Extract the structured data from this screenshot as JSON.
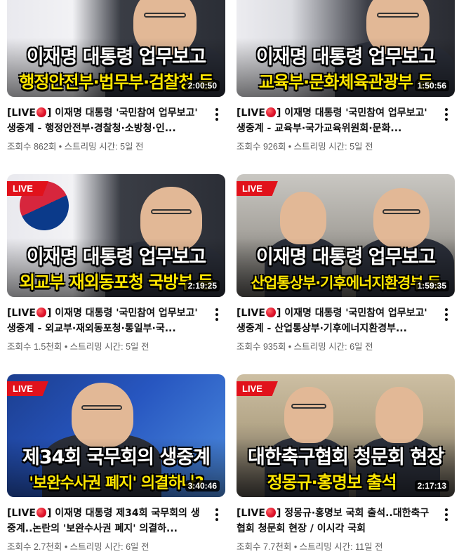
{
  "videos": [
    {
      "caption_top": "이재명 대통령 업무보고",
      "caption_bottom": "행정안전부·법무부·검찰청 등",
      "live_badge": "",
      "duration": "2:00:50",
      "title_prefix": "[LIVE",
      "title_rest": "] 이재명 대통령 '국민참여 업무보고' 생중계 - 행정안전부·경찰청·소방청·인...",
      "stats": "조회수 862회 • 스트리밍 시간: 5일 전"
    },
    {
      "caption_top": "이재명 대통령 업무보고",
      "caption_bottom": "교육부·문화체육관광부 등",
      "live_badge": "",
      "duration": "1:50:56",
      "title_prefix": "[LIVE",
      "title_rest": "] 이재명 대통령 '국민참여 업무보고' 생중계 - 교육부·국가교육위원회·문화...",
      "stats": "조회수 926회 • 스트리밍 시간: 5일 전"
    },
    {
      "caption_top": "이재명 대통령 업무보고",
      "caption_bottom": "외교부 재외동포청 국방부 등",
      "live_badge": "LIVE",
      "duration": "2:19:25",
      "title_prefix": "[LIVE",
      "title_rest": "] 이재명 대통령 '국민참여 업무보고' 생중계 - 외교부·재외동포청·통일부·국...",
      "stats": "조회수 1.5천회 • 스트리밍 시간: 5일 전"
    },
    {
      "caption_top": "이재명 대통령 업무보고",
      "caption_bottom": "산업통상부·기후에너지환경부 등",
      "live_badge": "LIVE",
      "duration": "1:59:35",
      "title_prefix": "[LIVE",
      "title_rest": "] 이재명 대통령 '국민참여 업무보고' 생중계 - 산업통상부·기후에너지환경부...",
      "stats": "조회수 935회 • 스트리밍 시간: 6일 전"
    },
    {
      "caption_top": "제34회 국무회의 생중계",
      "caption_bottom": "'보완수사권 폐지' 의결하나?",
      "live_badge": "LIVE",
      "duration": "3:40:46",
      "title_prefix": "[LIVE",
      "title_rest": "] 이재명 대통령 제34회 국무회의 생중계..논란의 '보완수사권 폐지' 의결하...",
      "stats": "조회수 2.7천회 • 스트리밍 시간: 6일 전"
    },
    {
      "caption_top": "대한축구협회 청문회 현장",
      "caption_bottom": "정몽규·홍명보 출석",
      "live_badge": "LIVE",
      "duration": "2:17:13",
      "title_prefix": "[LIVE",
      "title_rest": "] 정몽규·홍명보 국회 출석..대한축구협회 청문회 현장 / 이시각 국회",
      "stats": "조회수 7.7천회 • 스트리밍 시간: 11일 전"
    }
  ]
}
